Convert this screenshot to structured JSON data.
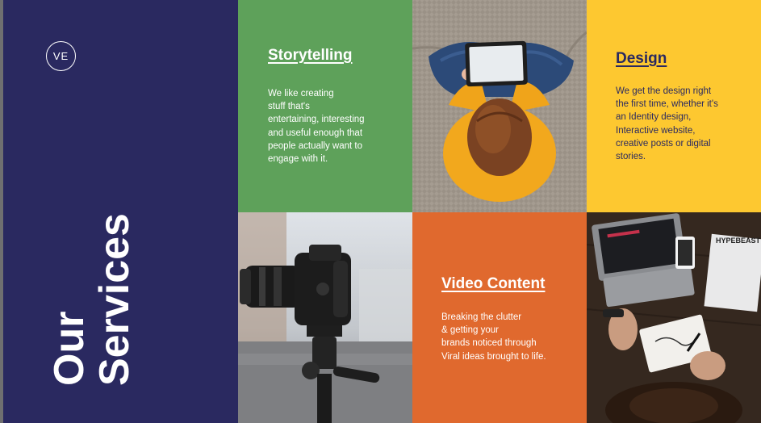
{
  "sidebar": {
    "logo": "VE",
    "title_line1": "Our",
    "title_line2": "Services"
  },
  "tiles": {
    "storytelling": {
      "heading": "Storytelling",
      "body": "We like creating\nstuff  that's\nentertaining,  interesting\nand useful  enough that\npeople  actually want to\nengage  with it."
    },
    "design": {
      "heading": "Design",
      "body": "We get the design right\nthe first time, whether it's\nan Identity design,\nInteractive website,\ncreative posts or digital\nstories."
    },
    "video": {
      "heading": "Video Content",
      "body": "Breaking the clutter\n& getting your\nbrands  noticed through\nViral  ideas brought to life."
    },
    "photos": {
      "tablet_photo": "woman-with-tablet-photo",
      "camera_photo": "camera-on-tripod-photo",
      "desk_photo": "designer-desk-photo",
      "magazine_text": "HYPEBEAST"
    }
  },
  "colors": {
    "navy": "#2a2960",
    "green": "#5ea15a",
    "yellow": "#fdc830",
    "orange": "#e0692e"
  }
}
